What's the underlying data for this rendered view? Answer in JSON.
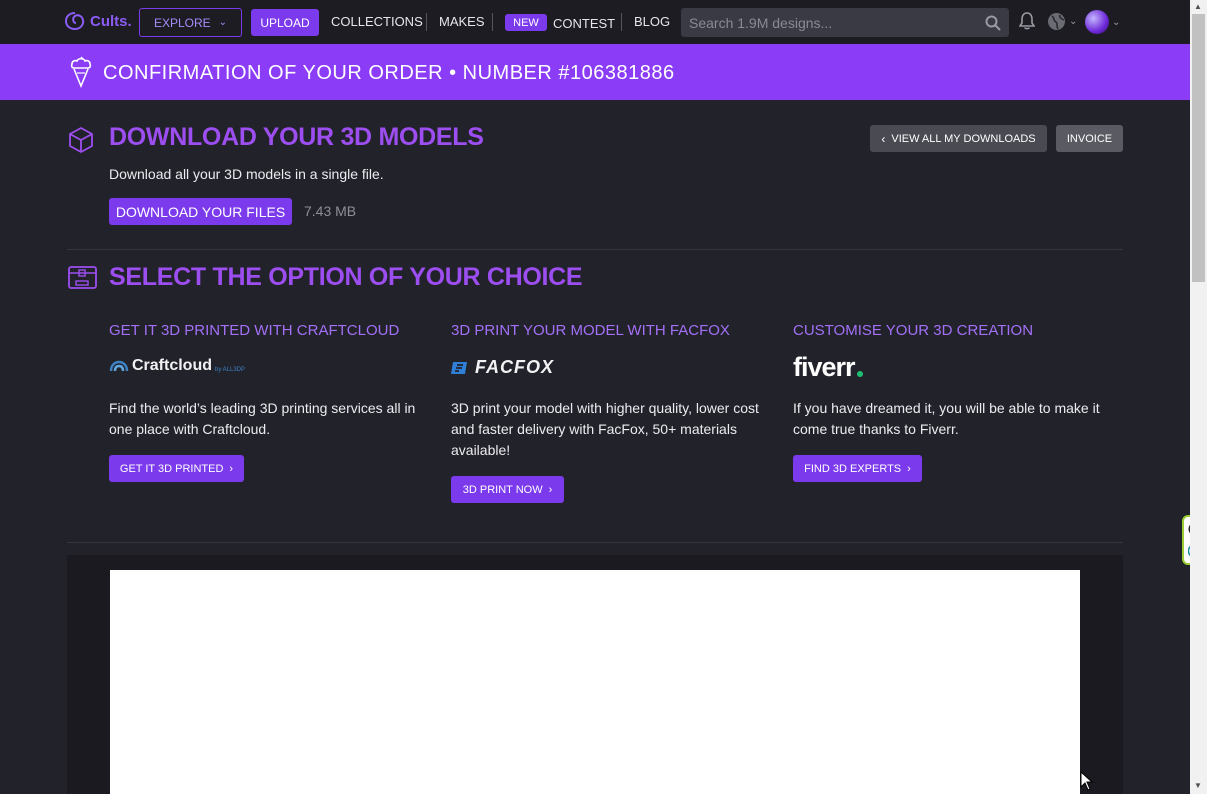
{
  "header": {
    "logo_text": "Cults.",
    "explore_label": "EXPLORE",
    "upload_label": "UPLOAD",
    "nav": {
      "collections": "COLLECTIONS",
      "makes": "MAKES",
      "new_badge": "NEW",
      "contest": "CONTEST",
      "blog": "BLOG"
    },
    "search_placeholder": "Search 1.9M designs..."
  },
  "banner": {
    "title": "CONFIRMATION OF YOUR ORDER • NUMBER #106381886"
  },
  "download": {
    "title": "DOWNLOAD YOUR 3D MODELS",
    "description": "Download all your 3D models in a single file.",
    "button_label": "DOWNLOAD YOUR FILES",
    "file_size": "7.43 MB",
    "view_all_label": "VIEW ALL MY DOWNLOADS",
    "invoice_label": "INVOICE"
  },
  "options": {
    "title": "SELECT THE OPTION OF YOUR CHOICE",
    "items": [
      {
        "heading": "GET IT 3D PRINTED WITH CRAFTCLOUD",
        "brand": "Craftcloud",
        "brand_suffix": "by ALL3DP",
        "description": "Find the world’s leading 3D printing services all in one place with Craftcloud.",
        "button": "GET IT 3D PRINTED"
      },
      {
        "heading": "3D PRINT YOUR MODEL WITH FACFOX",
        "brand": "FACFOX",
        "description": "3D print your model with higher quality, lower cost and faster delivery with FacFox, 50+ materials available!",
        "button": "3D PRINT NOW"
      },
      {
        "heading": "CUSTOMISE YOUR 3D CREATION",
        "brand": "fiverr",
        "description": "If you have dreamed it, you will be able to make it come true thanks to Fiverr.",
        "button": "FIND 3D EXPERTS"
      }
    ]
  },
  "colors": {
    "accent": "#7c3aed",
    "banner": "#8b3cf6",
    "background": "#22222a"
  }
}
